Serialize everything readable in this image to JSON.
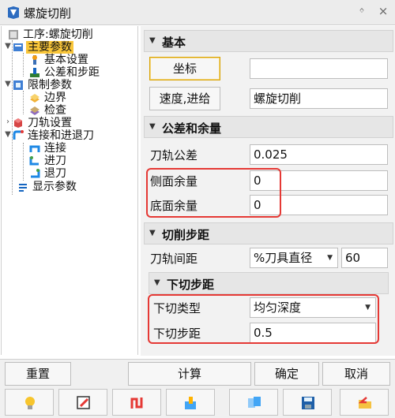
{
  "window": {
    "title": "螺旋切削",
    "pin_glyph": "ᛜ",
    "close_glyph": "×"
  },
  "tree": {
    "items": [
      {
        "label": "工序:螺旋切削",
        "icon": "operation-icon"
      },
      {
        "label": "主要参数",
        "icon": "params-icon",
        "selected": true
      },
      {
        "label": "基本设置",
        "icon": "settings-icon"
      },
      {
        "label": "公差和步距",
        "icon": "tolerance-icon"
      },
      {
        "label": "限制参数",
        "icon": "limit-icon"
      },
      {
        "label": "边界",
        "icon": "boundary-icon"
      },
      {
        "label": "检查",
        "icon": "check-icon"
      },
      {
        "label": "刀轨设置",
        "icon": "toolpath-icon"
      },
      {
        "label": "连接和进退刀",
        "icon": "link-icon"
      },
      {
        "label": "连接",
        "icon": "connect-icon"
      },
      {
        "label": "进刀",
        "icon": "lead-in-icon"
      },
      {
        "label": "退刀",
        "icon": "lead-out-icon"
      },
      {
        "label": "显示参数",
        "icon": "display-icon"
      }
    ]
  },
  "basic": {
    "header": "基本",
    "coord_button": "坐标",
    "coord_value": "",
    "speed_button": "速度,进给",
    "speed_value": "螺旋切削"
  },
  "tolerance": {
    "header": "公差和余量",
    "path_tol_label": "刀轨公差",
    "path_tol_value": "0.025",
    "side_label": "侧面余量",
    "side_value": "0",
    "bottom_label": "底面余量",
    "bottom_value": "0"
  },
  "cut_step": {
    "header": "切削步距",
    "spacing_label": "刀轨间距",
    "spacing_mode": "%刀具直径",
    "spacing_value": "60"
  },
  "down_step": {
    "header": "下切步距",
    "type_label": "下切类型",
    "type_value": "均匀深度",
    "step_label": "下切步距",
    "step_value": "0.5"
  },
  "actions": {
    "reset": "重置",
    "compute": "计算",
    "ok": "确定",
    "cancel": "取消"
  },
  "colors": {
    "highlight": "#f9c63a",
    "annotation": "#e53935"
  }
}
